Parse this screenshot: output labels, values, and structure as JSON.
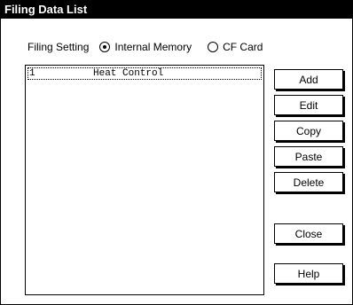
{
  "window": {
    "title": "Filing Data List"
  },
  "filing_setting": {
    "label": "Filing Setting",
    "options": [
      {
        "label": "Internal Memory",
        "selected": true
      },
      {
        "label": "CF Card",
        "selected": false
      }
    ]
  },
  "list": {
    "items": [
      {
        "number": "1",
        "name": "Heat Control"
      }
    ]
  },
  "buttons": {
    "add": "Add",
    "edit": "Edit",
    "copy": "Copy",
    "paste": "Paste",
    "delete": "Delete",
    "close": "Close",
    "help": "Help"
  }
}
